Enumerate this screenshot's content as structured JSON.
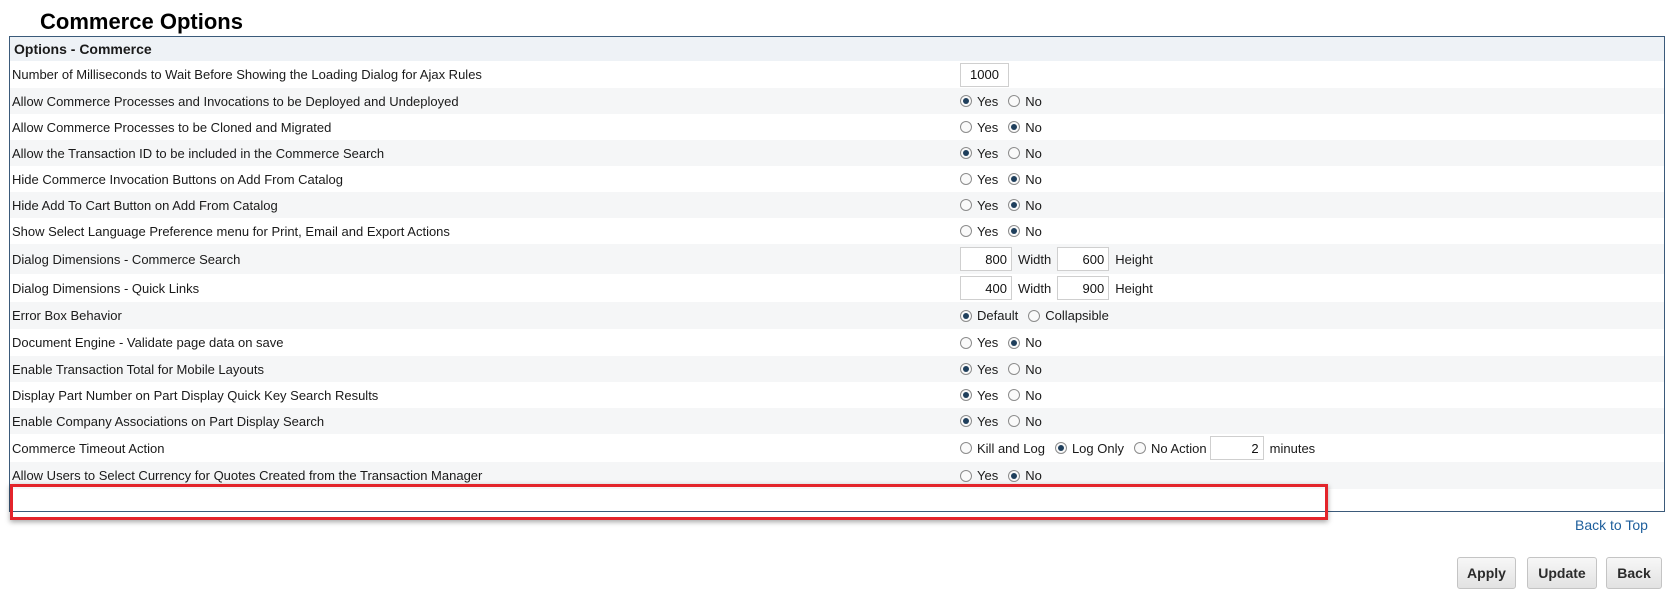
{
  "page": {
    "title": "Commerce Options"
  },
  "panel": {
    "header": "Options - Commerce",
    "rows": [
      {
        "label": "Number of Milliseconds to Wait Before Showing the Loading Dialog for Ajax Rules",
        "input_value": "1000"
      },
      {
        "label": "Allow Commerce Processes and Invocations to be Deployed and Undeployed",
        "opt1": "Yes",
        "opt2": "No",
        "selected": "Yes"
      },
      {
        "label": "Allow Commerce Processes to be Cloned and Migrated",
        "opt1": "Yes",
        "opt2": "No",
        "selected": "No"
      },
      {
        "label": "Allow the Transaction ID to be included in the Commerce Search",
        "opt1": "Yes",
        "opt2": "No",
        "selected": "Yes"
      },
      {
        "label": "Hide Commerce Invocation Buttons on Add From Catalog",
        "opt1": "Yes",
        "opt2": "No",
        "selected": "No"
      },
      {
        "label": "Hide Add To Cart Button on Add From Catalog",
        "opt1": "Yes",
        "opt2": "No",
        "selected": "No"
      },
      {
        "label": "Show Select Language Preference menu for Print, Email and Export Actions",
        "opt1": "Yes",
        "opt2": "No",
        "selected": "No"
      },
      {
        "label": "Dialog Dimensions - Commerce Search",
        "width_value": "800",
        "width_label": "Width",
        "height_value": "600",
        "height_label": "Height"
      },
      {
        "label": "Dialog Dimensions - Quick Links",
        "width_value": "400",
        "width_label": "Width",
        "height_value": "900",
        "height_label": "Height"
      },
      {
        "label": "Error Box Behavior",
        "opt1": "Default",
        "opt2": "Collapsible",
        "selected": "Default"
      },
      {
        "label": "Document Engine - Validate page data on save",
        "opt1": "Yes",
        "opt2": "No",
        "selected": "No"
      },
      {
        "label": "Enable Transaction Total for Mobile Layouts",
        "opt1": "Yes",
        "opt2": "No",
        "selected": "Yes"
      },
      {
        "label": "Display Part Number on Part Display Quick Key Search Results",
        "opt1": "Yes",
        "opt2": "No",
        "selected": "Yes"
      },
      {
        "label": "Enable Company Associations on Part Display Search",
        "opt1": "Yes",
        "opt2": "No",
        "selected": "Yes"
      },
      {
        "label": "Commerce Timeout Action",
        "opt1": "Kill and Log",
        "opt2": "Log Only",
        "opt3": "No Action",
        "selected": "Log Only",
        "minutes_value": "2",
        "minutes_label": "minutes",
        "highlighted": true
      },
      {
        "label": "Allow Users to Select Currency for Quotes Created from the Transaction Manager",
        "opt1": "Yes",
        "opt2": "No",
        "selected": "No"
      }
    ]
  },
  "links": {
    "back_to_top": "Back to Top"
  },
  "buttons": {
    "apply": "Apply",
    "update": "Update",
    "back": "Back"
  },
  "colors": {
    "highlight": "#e3242b",
    "panel_border": "#3b5a7a",
    "link": "#1d5e9c"
  }
}
